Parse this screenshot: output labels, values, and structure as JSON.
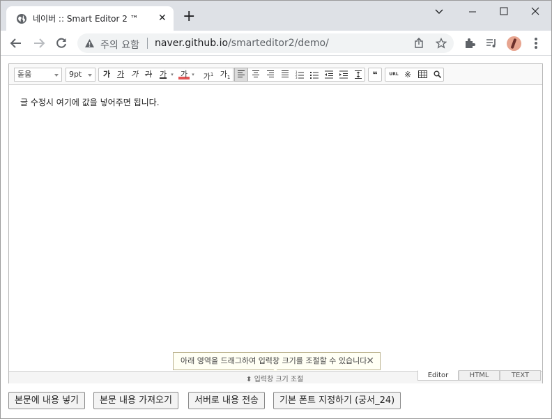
{
  "browser": {
    "tab_title": "네이버 :: Smart Editor 2 ™",
    "tab_close": "✕",
    "new_tab": "+",
    "security_warning": "주의 요함",
    "url_host": "naver.github.io",
    "url_path": "/smarteditor2/demo/"
  },
  "editor": {
    "font_family": "돋움",
    "font_size": "9pt",
    "format_buttons": [
      "가",
      "가",
      "가",
      "가",
      "가",
      "가"
    ],
    "superscript": "가",
    "subscript": "가",
    "url_button": "URL",
    "quote_button": "❝",
    "content": "글 수정시 여기에 값을 넣어주면 됩니다.",
    "resize_tip": "아래 영역을 드래그하여 입력창 크기를 조절할 수 있습니다.",
    "resize_label": "입력창 크기 조절",
    "modes": [
      "Editor",
      "HTML",
      "TEXT"
    ]
  },
  "buttons": {
    "insert_content": "본문에 내용 넣기",
    "get_content": "본문 내용 가져오기",
    "send_to_server": "서버로 내용 전송",
    "set_default_font": "기본 폰트 지정하기 (궁서_24)"
  }
}
